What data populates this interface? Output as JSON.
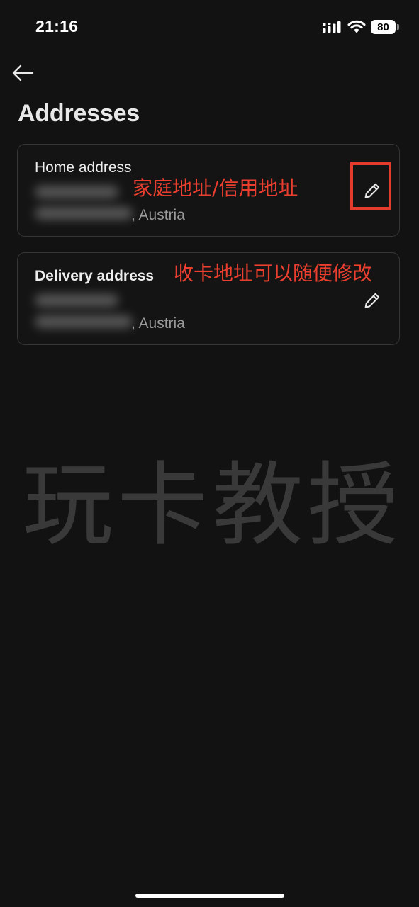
{
  "status_bar": {
    "time": "21:16",
    "battery_level": "80",
    "icons": [
      "signal-icon",
      "wifi-icon",
      "battery-icon"
    ]
  },
  "header": {
    "back_icon": "arrow-left-icon",
    "title": "Addresses"
  },
  "addresses": [
    {
      "label": "Home address",
      "country_suffix": ", Austria",
      "edit_icon": "pencil-icon",
      "annotation": "家庭地址/信用地址"
    },
    {
      "label": "Delivery address",
      "country_suffix": ", Austria",
      "edit_icon": "pencil-icon",
      "annotation": "收卡地址可以随便修改"
    }
  ],
  "watermark": "玩卡教授",
  "colors": {
    "background": "#121212",
    "card_border": "#363636",
    "annotation_red": "#e33b2c"
  }
}
